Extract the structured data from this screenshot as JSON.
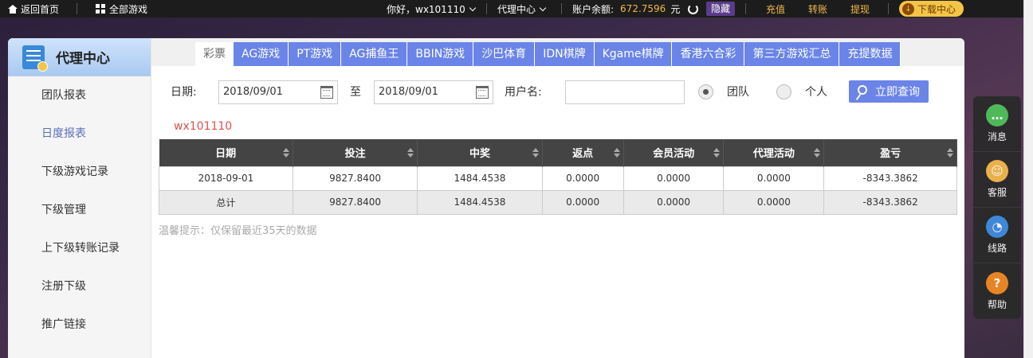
{
  "topbar": {
    "home": "返回首页",
    "all_games": "全部游戏",
    "greeting": "你好，wx101110",
    "agent_center": "代理中心",
    "balance_label": "账户余额:",
    "balance_value": "672.7596",
    "balance_unit": "元",
    "hide": "隐藏",
    "recharge": "充值",
    "transfer": "转账",
    "withdraw": "提现",
    "download": "下载中心"
  },
  "sidebar": {
    "title": "代理中心",
    "items": [
      {
        "label": "团队报表"
      },
      {
        "label": "日度报表"
      },
      {
        "label": "下级游戏记录"
      },
      {
        "label": "下级管理"
      },
      {
        "label": "上下级转账记录"
      },
      {
        "label": "注册下级"
      },
      {
        "label": "推广链接"
      }
    ]
  },
  "tabs": [
    {
      "label": "彩票"
    },
    {
      "label": "AG游戏"
    },
    {
      "label": "PT游戏"
    },
    {
      "label": "AG捕鱼王"
    },
    {
      "label": "BBIN游戏"
    },
    {
      "label": "沙巴体育"
    },
    {
      "label": "IDN棋牌"
    },
    {
      "label": "Kgame棋牌"
    },
    {
      "label": "香港六合彩"
    },
    {
      "label": "第三方游戏汇总"
    },
    {
      "label": "充提数据"
    }
  ],
  "filter": {
    "date_label": "日期:",
    "date_from": "2018/09/01",
    "to_label": "至",
    "date_to": "2018/09/01",
    "username_label": "用户名:",
    "username_value": "",
    "team_label": "团队",
    "personal_label": "个人",
    "query_button": "立即查询"
  },
  "username_tag": "wx101110",
  "table": {
    "headers": [
      "日期",
      "投注",
      "中奖",
      "返点",
      "会员活动",
      "代理活动",
      "盈亏"
    ],
    "rows": [
      [
        "2018-09-01",
        "9827.8400",
        "1484.4538",
        "0.0000",
        "0.0000",
        "0.0000",
        "-8343.3862"
      ]
    ],
    "total": [
      "总计",
      "9827.8400",
      "1484.4538",
      "0.0000",
      "0.0000",
      "0.0000",
      "-8343.3862"
    ]
  },
  "tip": "温馨提示：仅保留最近35天的数据",
  "float_panel": {
    "message": "消息",
    "service": "客服",
    "route": "线路",
    "help": "帮助"
  },
  "colors": {
    "accent_blue": "#6a84e8",
    "balance_gold": "#f2b84b",
    "alert_red": "#d9534f"
  }
}
